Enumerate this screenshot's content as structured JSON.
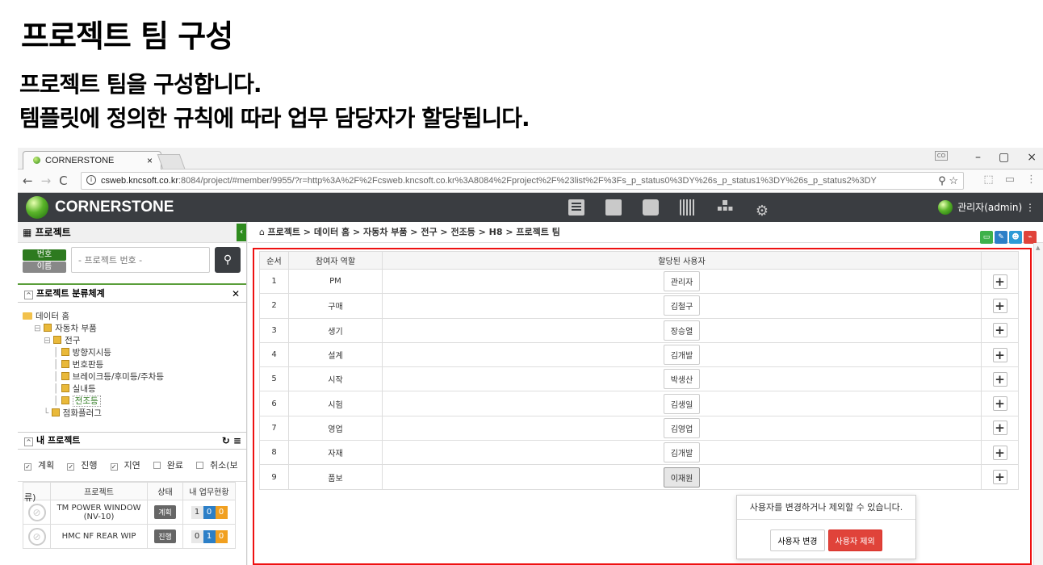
{
  "slide": {
    "title": "프로젝트 팀 구성",
    "desc_line1": "프로젝트 팀을 구성합니다.",
    "desc_line2": "템플릿에 정의한 규칙에 따라 업무 담당자가 할당됩니다."
  },
  "browser": {
    "tab_title": "CORNERSTONE",
    "tab_close": "×",
    "url_host": "csweb.kncsoft.co.kr",
    "url_rest": ":8084/project/#member/9955/?r=http%3A%2F%2Fcsweb.kncsoft.co.kr%3A8084%2Fproject%2F%23list%2F%3Fs_p_status0%3DY%26s_p_status1%3DY%26s_p_status2%3DY",
    "window_controls": [
      "–",
      "▢",
      "×"
    ],
    "co_badge": "CO"
  },
  "app": {
    "brand": "CORNERSTONE",
    "user": "관리자(admin)",
    "user_menu": "⋮"
  },
  "sidebar": {
    "header": "프로젝트",
    "btn_number": "번호",
    "btn_name": "이름",
    "search_placeholder": "- 프로젝트 번호 -",
    "taxonomy_title": "프로젝트 분류체계",
    "tree": [
      {
        "label": "데이터 홈",
        "level": 0,
        "kind": "folder"
      },
      {
        "label": "자동차 부품",
        "level": 1,
        "kind": "pkg"
      },
      {
        "label": "전구",
        "level": 2,
        "kind": "pkg"
      },
      {
        "label": "방향지시등",
        "level": 3,
        "kind": "pkg"
      },
      {
        "label": "번호판등",
        "level": 3,
        "kind": "pkg"
      },
      {
        "label": "브레이크등/후미등/주차등",
        "level": 3,
        "kind": "pkg"
      },
      {
        "label": "실내등",
        "level": 3,
        "kind": "pkg"
      },
      {
        "label": "전조등",
        "level": 3,
        "kind": "pkg",
        "selected": true
      },
      {
        "label": "점화플러그",
        "level": 2,
        "kind": "pkg"
      }
    ],
    "myproj_title": "내 프로젝트",
    "filters": [
      "계획",
      "진행",
      "지연",
      "완료",
      "취소(보류)"
    ],
    "filter_checked": [
      true,
      true,
      true,
      false,
      false
    ],
    "ptable_headers": [
      "프로젝트",
      "상태",
      "내 업무현황"
    ],
    "projects": [
      {
        "name": "TM POWER WINDOW (NV-10)",
        "status": "계획",
        "c1": "1",
        "c2": "0",
        "c3": "0"
      },
      {
        "name": "HMC NF REAR WIP",
        "status": "진행",
        "c1": "0",
        "c2": "1",
        "c3": "0"
      }
    ]
  },
  "main": {
    "breadcrumb": "프로젝트 > 데이터 홈 > 자동차 부품 > 전구 > 전조등 > H8 > 프로젝트 팀",
    "headers": [
      "순서",
      "참여자 역할",
      "할당된 사용자"
    ],
    "rows": [
      {
        "no": "1",
        "role": "PM",
        "user": "관리자"
      },
      {
        "no": "2",
        "role": "구매",
        "user": "김철구"
      },
      {
        "no": "3",
        "role": "생기",
        "user": "장승열"
      },
      {
        "no": "4",
        "role": "설계",
        "user": "김개발"
      },
      {
        "no": "5",
        "role": "시작",
        "user": "박생산"
      },
      {
        "no": "6",
        "role": "시험",
        "user": "김생일"
      },
      {
        "no": "7",
        "role": "영업",
        "user": "김영업"
      },
      {
        "no": "8",
        "role": "자재",
        "user": "김개발"
      },
      {
        "no": "9",
        "role": "품보",
        "user": "이재원"
      }
    ],
    "add_label": "+",
    "popover_msg": "사용자를 변경하거나 제외할 수 있습니다.",
    "btn_change": "사용자 변경",
    "btn_exclude": "사용자 제외"
  },
  "colors": {
    "accent": "#2e8b1e",
    "header_bg": "#3a3d41",
    "highlight": "#e11111",
    "danger": "#e0433a"
  }
}
